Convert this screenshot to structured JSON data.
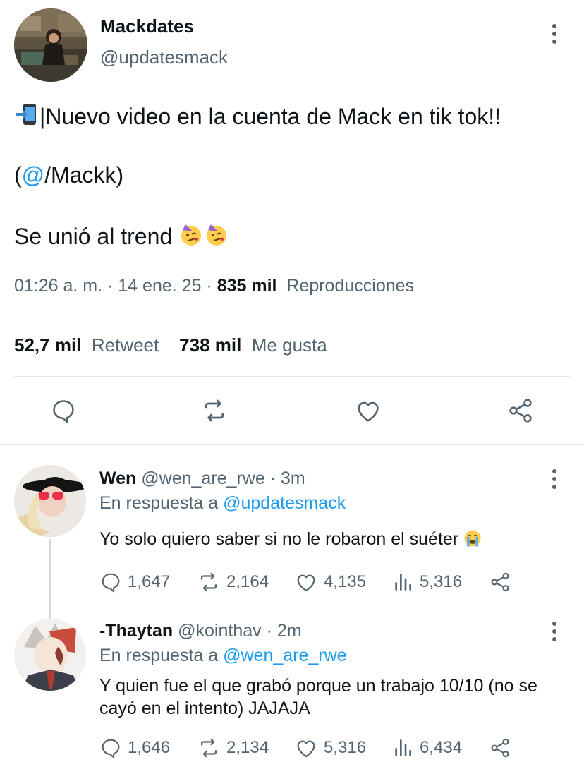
{
  "tweet": {
    "author_name": "Mackdates",
    "author_handle": "@updatesmack",
    "line1": "|Nuevo video en la cuenta de Mack en tik tok!!",
    "line2_open": "(",
    "line2_at": "@",
    "line2_rest": "/Mackk)",
    "line3": "Se unió al trend",
    "time": "01:26 a. m.",
    "sep": " · ",
    "date": "14 ene. 25",
    "views_count": "835 mil",
    "views_label": "Reproducciones",
    "retweets_count": "52,7 mil",
    "retweets_label": "Retweet",
    "likes_count": "738 mil",
    "likes_label": "Me gusta"
  },
  "replies": [
    {
      "name": "Wen",
      "handle": "@wen_are_rwe",
      "age": "· 3m",
      "reply_prefix": "En respuesta a",
      "reply_to": "@updatesmack",
      "text": "Yo solo quiero saber si no le robaron el suéter",
      "comments": "1,647",
      "retweets": "2,164",
      "likes": "4,135",
      "views": "5,316"
    },
    {
      "name": "-Thaytan",
      "handle": "@kointhav",
      "age": "· 2m",
      "reply_prefix": "En respuesta a",
      "reply_to": "@wen_are_rwe",
      "text": "Y quien fue el que grabó porque un trabajo 10/10 (no se cayó en el intento) JAJAJA",
      "comments": "1,646",
      "retweets": "2,134",
      "likes": "5,316",
      "views": "6,434"
    }
  ],
  "colors": {
    "accent": "#1d9bf0",
    "text": "#0f1419",
    "secondary": "#536471",
    "divider": "#e1e4e8"
  },
  "icons": [
    "more-icon",
    "phone-arrow-emoji",
    "party-face-emoji",
    "crying-face-emoji",
    "reply-icon",
    "retweet-icon",
    "like-icon",
    "share-icon",
    "views-icon"
  ]
}
